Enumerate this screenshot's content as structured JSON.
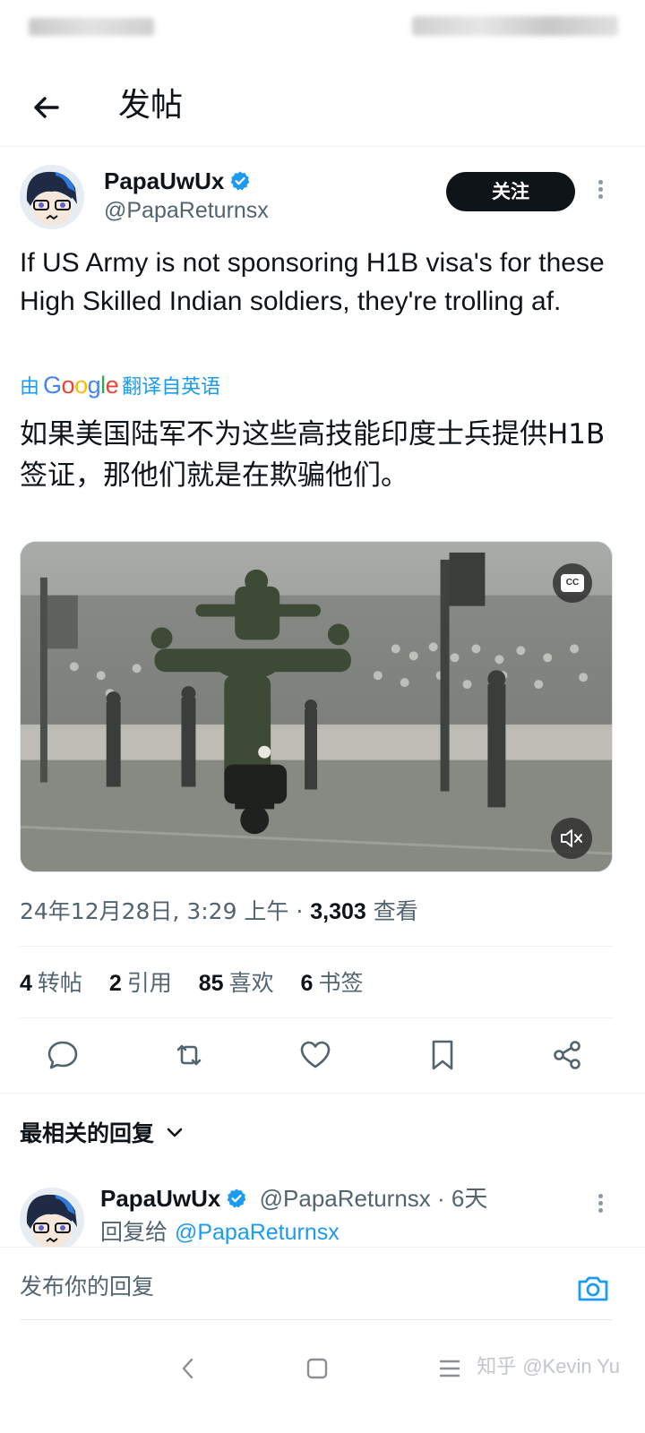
{
  "header": {
    "title": "发帖"
  },
  "tweet": {
    "author_name": "PapaUwUx",
    "author_handle": "@PapaReturnsx",
    "follow_label": "关注",
    "text": "If US Army is not sponsoring H1B visa's for these High Skilled Indian soldiers, they're trolling af.",
    "translate_prefix": "由",
    "translate_provider": "Google",
    "translate_suffix": "翻译自英语",
    "translated_text": "如果美国陆军不为这些高技能印度士兵提供H1B 签证，那他们就是在欺骗他们。",
    "media": {
      "cc_label": "CC"
    },
    "date_time": "24年12月28日, 3:29 上午 · ",
    "views_count": "3,303",
    "views_label": " 查看",
    "stats": [
      {
        "count": "4",
        "label": "转帖"
      },
      {
        "count": "2",
        "label": "引用"
      },
      {
        "count": "85",
        "label": "喜欢"
      },
      {
        "count": "6",
        "label": "书签"
      }
    ]
  },
  "replies": {
    "sort_label": "最相关的回复",
    "items": [
      {
        "author_name": "PapaUwUx",
        "author_handle": "@PapaReturnsx",
        "age": " · 6天",
        "reply_to_label": "回复给 ",
        "reply_to_handle": "@PapaReturnsx"
      }
    ]
  },
  "compose": {
    "placeholder": "发布你的回复"
  },
  "watermark": {
    "site": "知乎",
    "user": "@Kevin Yu"
  },
  "colors": {
    "accent": "#1d9bf0",
    "text": "#0f1419",
    "secondary": "#536471",
    "follow_bg": "#0f1419"
  }
}
